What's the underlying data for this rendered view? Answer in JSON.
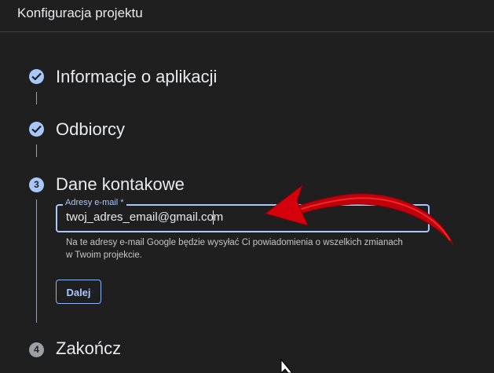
{
  "header": {
    "title": "Konfiguracja projektu"
  },
  "steps": [
    {
      "label": "Informacje o aplikacji",
      "state": "done",
      "icon": "check-icon"
    },
    {
      "label": "Odbiorcy",
      "state": "done",
      "icon": "check-icon"
    },
    {
      "label": "Dane kontakowe",
      "state": "active",
      "number": "3"
    },
    {
      "label": "Zakończ",
      "state": "inactive",
      "number": "4"
    }
  ],
  "contact": {
    "email_label": "Adresy e-mail *",
    "email_value": "twoj_adres_email@gmail.com",
    "hint": "Na te adresy e-mail Google będzie wysyłać Ci powiadomienia o wszelkich zmianach w Twoim projekcie.",
    "next_label": "Dalej"
  },
  "colors": {
    "accent": "#a8c7fa",
    "background": "#1f1f1f",
    "annotation_arrow": "#e8000b"
  }
}
